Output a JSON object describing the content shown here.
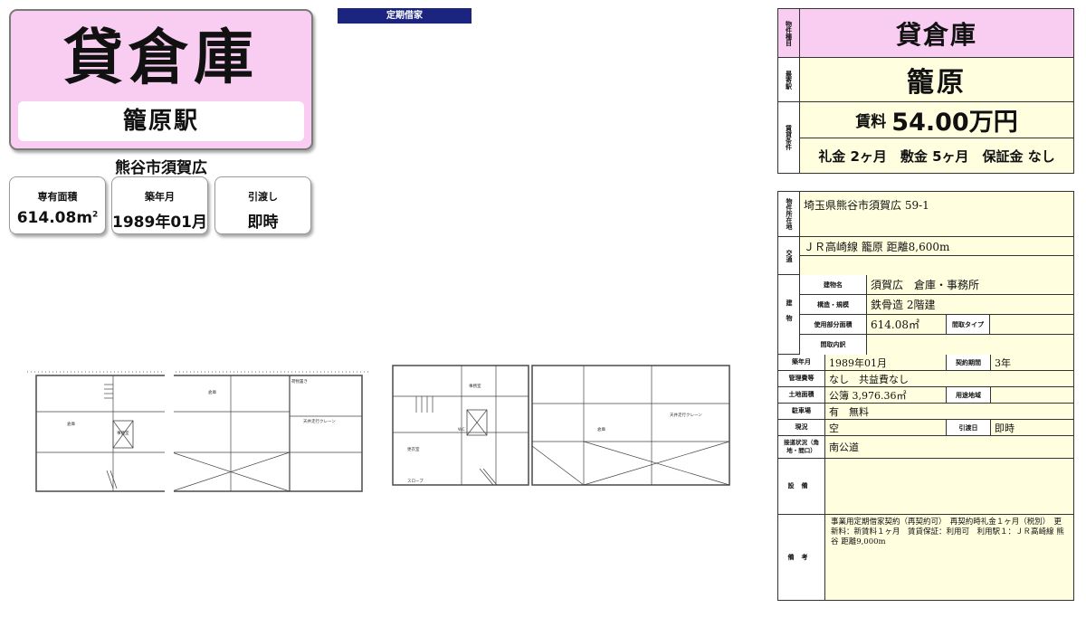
{
  "header": {
    "property_type": "貸倉庫",
    "station": "籠原駅",
    "address": "熊谷市須賀広",
    "specs": [
      {
        "label": "専有面積",
        "value": "614.08",
        "unit": "m",
        "sup": "2"
      },
      {
        "label": "築年月",
        "value": "1989年01月",
        "unit": "",
        "sup": ""
      },
      {
        "label": "引渡し",
        "value": "即時",
        "unit": "",
        "sup": ""
      }
    ],
    "tag": "定期借家"
  },
  "summary": {
    "type_label": "物件種目",
    "type_value": "貸倉庫",
    "station_label": "最寄駅",
    "station_value": "籠原",
    "conditions_label": "賃貸条件",
    "rent_prefix": "賃料",
    "rent_value": "54.00万円",
    "deposits": "礼金 2ヶ月　敷金 5ヶ月　保証金 なし"
  },
  "detail": {
    "location_label": "物件所在地",
    "location_value": "埼玉県熊谷市須賀広 59-1",
    "transport_label": "交通",
    "transport_value": "ＪＲ高崎線 籠原 距離8,600m",
    "building_label": "建物",
    "building_name_label": "建物名",
    "building_name_value": "須賀広　倉庫・事務所",
    "structure_label": "構造・規模",
    "structure_value": "鉄骨造 2階建",
    "area_label": "使用部分面積",
    "area_value": "614.08㎡",
    "layout_type_label": "間取タイプ",
    "layout_detail_label": "間取内訳",
    "built_label": "築年月",
    "built_value": "1989年01月",
    "contract_label": "契約期間",
    "contract_value": "3年",
    "mgmt_label": "管理費等",
    "mgmt_value": "なし　共益費なし",
    "land_label": "土地面積",
    "land_value": "公簿 3,976.36㎡",
    "zoning_label": "用途地域",
    "parking_label": "駐車場",
    "parking_value": "有　無料",
    "status_label": "現況",
    "status_value": "空",
    "handover_label": "引渡日",
    "handover_value": "即時",
    "road_label": "接道状況（角地・間口）",
    "road_value": "南公道",
    "equipment_label": "設備",
    "remarks_label": "備考",
    "remarks_value": "事業用定期借家契約（再契約可）　再契約時礼金１ヶ月（税別）　更新料：新賃料１ヶ月　賃貸保証：利用可　利用駅１：ＪＲ高崎線 熊谷 距離9,000m"
  },
  "plans": {
    "labels": [
      "倉庫",
      "荷物置き",
      "天井走行クレーン",
      "事務室",
      "更衣室",
      "WC",
      "スロープ"
    ]
  }
}
